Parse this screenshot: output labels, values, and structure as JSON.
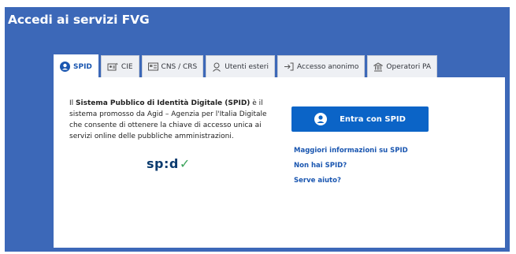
{
  "header": {
    "title": "Accedi ai servizi FVG"
  },
  "tabs": [
    {
      "label": "SPID",
      "icon": "user-circle-icon",
      "active": true
    },
    {
      "label": "CIE",
      "icon": "id-card-icon",
      "active": false
    },
    {
      "label": "CNS / CRS",
      "icon": "smart-card-icon",
      "active": false
    },
    {
      "label": "Utenti esteri",
      "icon": "user-outline-icon",
      "active": false
    },
    {
      "label": "Accesso anonimo",
      "icon": "login-arrow-icon",
      "active": false
    },
    {
      "label": "Operatori PA",
      "icon": "institution-icon",
      "active": false
    }
  ],
  "spid_panel": {
    "description_prefix": "Il ",
    "description_bold": "Sistema Pubblico di Identità Digitale (SPID)",
    "description_rest": " è il sistema promosso da Agid – Agenzia per l'Italia Digitale che consente di ottenere la chiave di accesso unica ai servizi online delle pubbliche amministrazioni.",
    "logo_text": "sp:d",
    "login_button_label": "Entra con SPID",
    "links": {
      "more_info": "Maggiori informazioni su SPID",
      "no_spid": "Non hai SPID?",
      "help": "Serve aiuto?"
    }
  },
  "colors": {
    "page_background": "#3c68b8",
    "primary_button": "#0b64c7",
    "link": "#1a56b0",
    "spid_check": "#3aa35a"
  }
}
